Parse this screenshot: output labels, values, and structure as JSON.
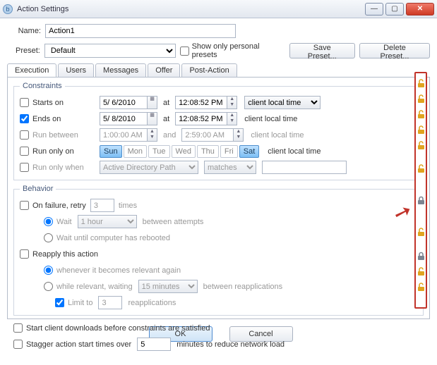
{
  "window": {
    "title": "Action Settings"
  },
  "form": {
    "name_label": "Name:",
    "name_value": "Action1",
    "preset_label": "Preset:",
    "preset_value": "Default",
    "show_personal_label": "Show only personal presets",
    "save_preset_label": "Save Preset...",
    "delete_preset_label": "Delete Preset..."
  },
  "tabs": {
    "execution": "Execution",
    "users": "Users",
    "messages": "Messages",
    "offer": "Offer",
    "post_action": "Post-Action"
  },
  "constraints": {
    "legend": "Constraints",
    "starts_on": "Starts on",
    "ends_on": "Ends on",
    "run_between": "Run between",
    "run_only_on": "Run only on",
    "run_only_when": "Run only when",
    "start_date": "5/ 6/2010",
    "end_date": "5/ 8/2010",
    "at": "at",
    "and": "and",
    "start_time": "12:08:52 PM",
    "end_time": "12:08:52 PM",
    "between_from": "1:00:00 AM",
    "between_to": "2:59:00 AM",
    "tz_select": "client local time",
    "tz_text": "client local time",
    "days": {
      "sun": "Sun",
      "mon": "Mon",
      "tue": "Tue",
      "wed": "Wed",
      "thu": "Thu",
      "fri": "Fri",
      "sat": "Sat"
    },
    "adpath": "Active Directory Path",
    "matches": "matches"
  },
  "behavior": {
    "legend": "Behavior",
    "on_failure": "On failure, retry",
    "times": "times",
    "retry_count": "3",
    "wait_label": "Wait",
    "wait_value": "1 hour",
    "between_attempts": "between attempts",
    "wait_reboot": "Wait until computer has rebooted",
    "reapply": "Reapply this action",
    "whenever": "whenever it becomes relevant again",
    "while_relevant": "while relevant, waiting",
    "while_wait": "15 minutes",
    "between_reapps": "between reapplications",
    "limit_to": "Limit to",
    "limit_value": "3",
    "reapplications": "reapplications"
  },
  "misc": {
    "start_downloads": "Start client downloads before constraints are satisfied",
    "stagger": "Stagger action start times over",
    "stagger_value": "5",
    "stagger_tail": "minutes to reduce network load"
  },
  "buttons": {
    "ok": "OK",
    "cancel": "Cancel"
  },
  "locks": [
    "open",
    "open",
    "open",
    "open",
    "open",
    "open",
    "closed",
    "open",
    "closed",
    "open",
    "open"
  ],
  "colors": {
    "lock_open": "#e0a420",
    "lock_closed": "#7c8491"
  }
}
